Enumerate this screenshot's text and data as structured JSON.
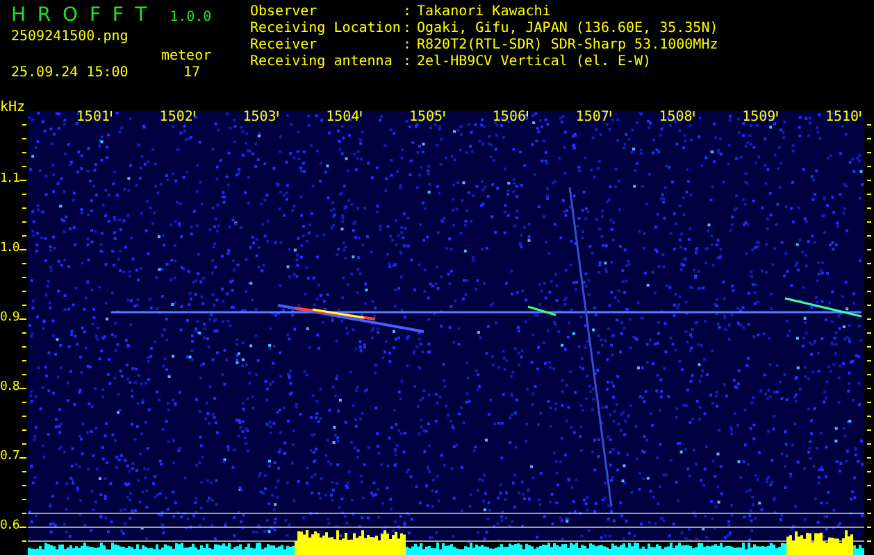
{
  "app": {
    "title": "HROFFT",
    "version": "1.0.0"
  },
  "file": {
    "name": "2509241500.png",
    "timestamp": "25.09.24 15:00"
  },
  "meteor": {
    "label": "meteor",
    "count": "17"
  },
  "station": [
    {
      "label": "Observer",
      "separator": ":",
      "value": "Takanori Kawachi"
    },
    {
      "label": "Receiving Location",
      "separator": ":",
      "value": "Ogaki, Gifu, JAPAN (136.60E, 35.35N)"
    },
    {
      "label": "Receiver",
      "separator": ":",
      "value": "R820T2(RTL-SDR) SDR-Sharp 53.1000MHz"
    },
    {
      "label": "Receiving antenna",
      "separator": ":",
      "value": "2el-HB9CV Vertical (el. E-W)"
    }
  ],
  "plot": {
    "y_unit": "kHz",
    "x_ticks": [
      "1501",
      "1502",
      "1503",
      "1504",
      "1505",
      "1506",
      "1507",
      "1508",
      "1509",
      "1510"
    ],
    "y_ticks": [
      "1.1",
      "1.0",
      "0.9",
      "0.8",
      "0.7",
      "0.6"
    ]
  }
}
